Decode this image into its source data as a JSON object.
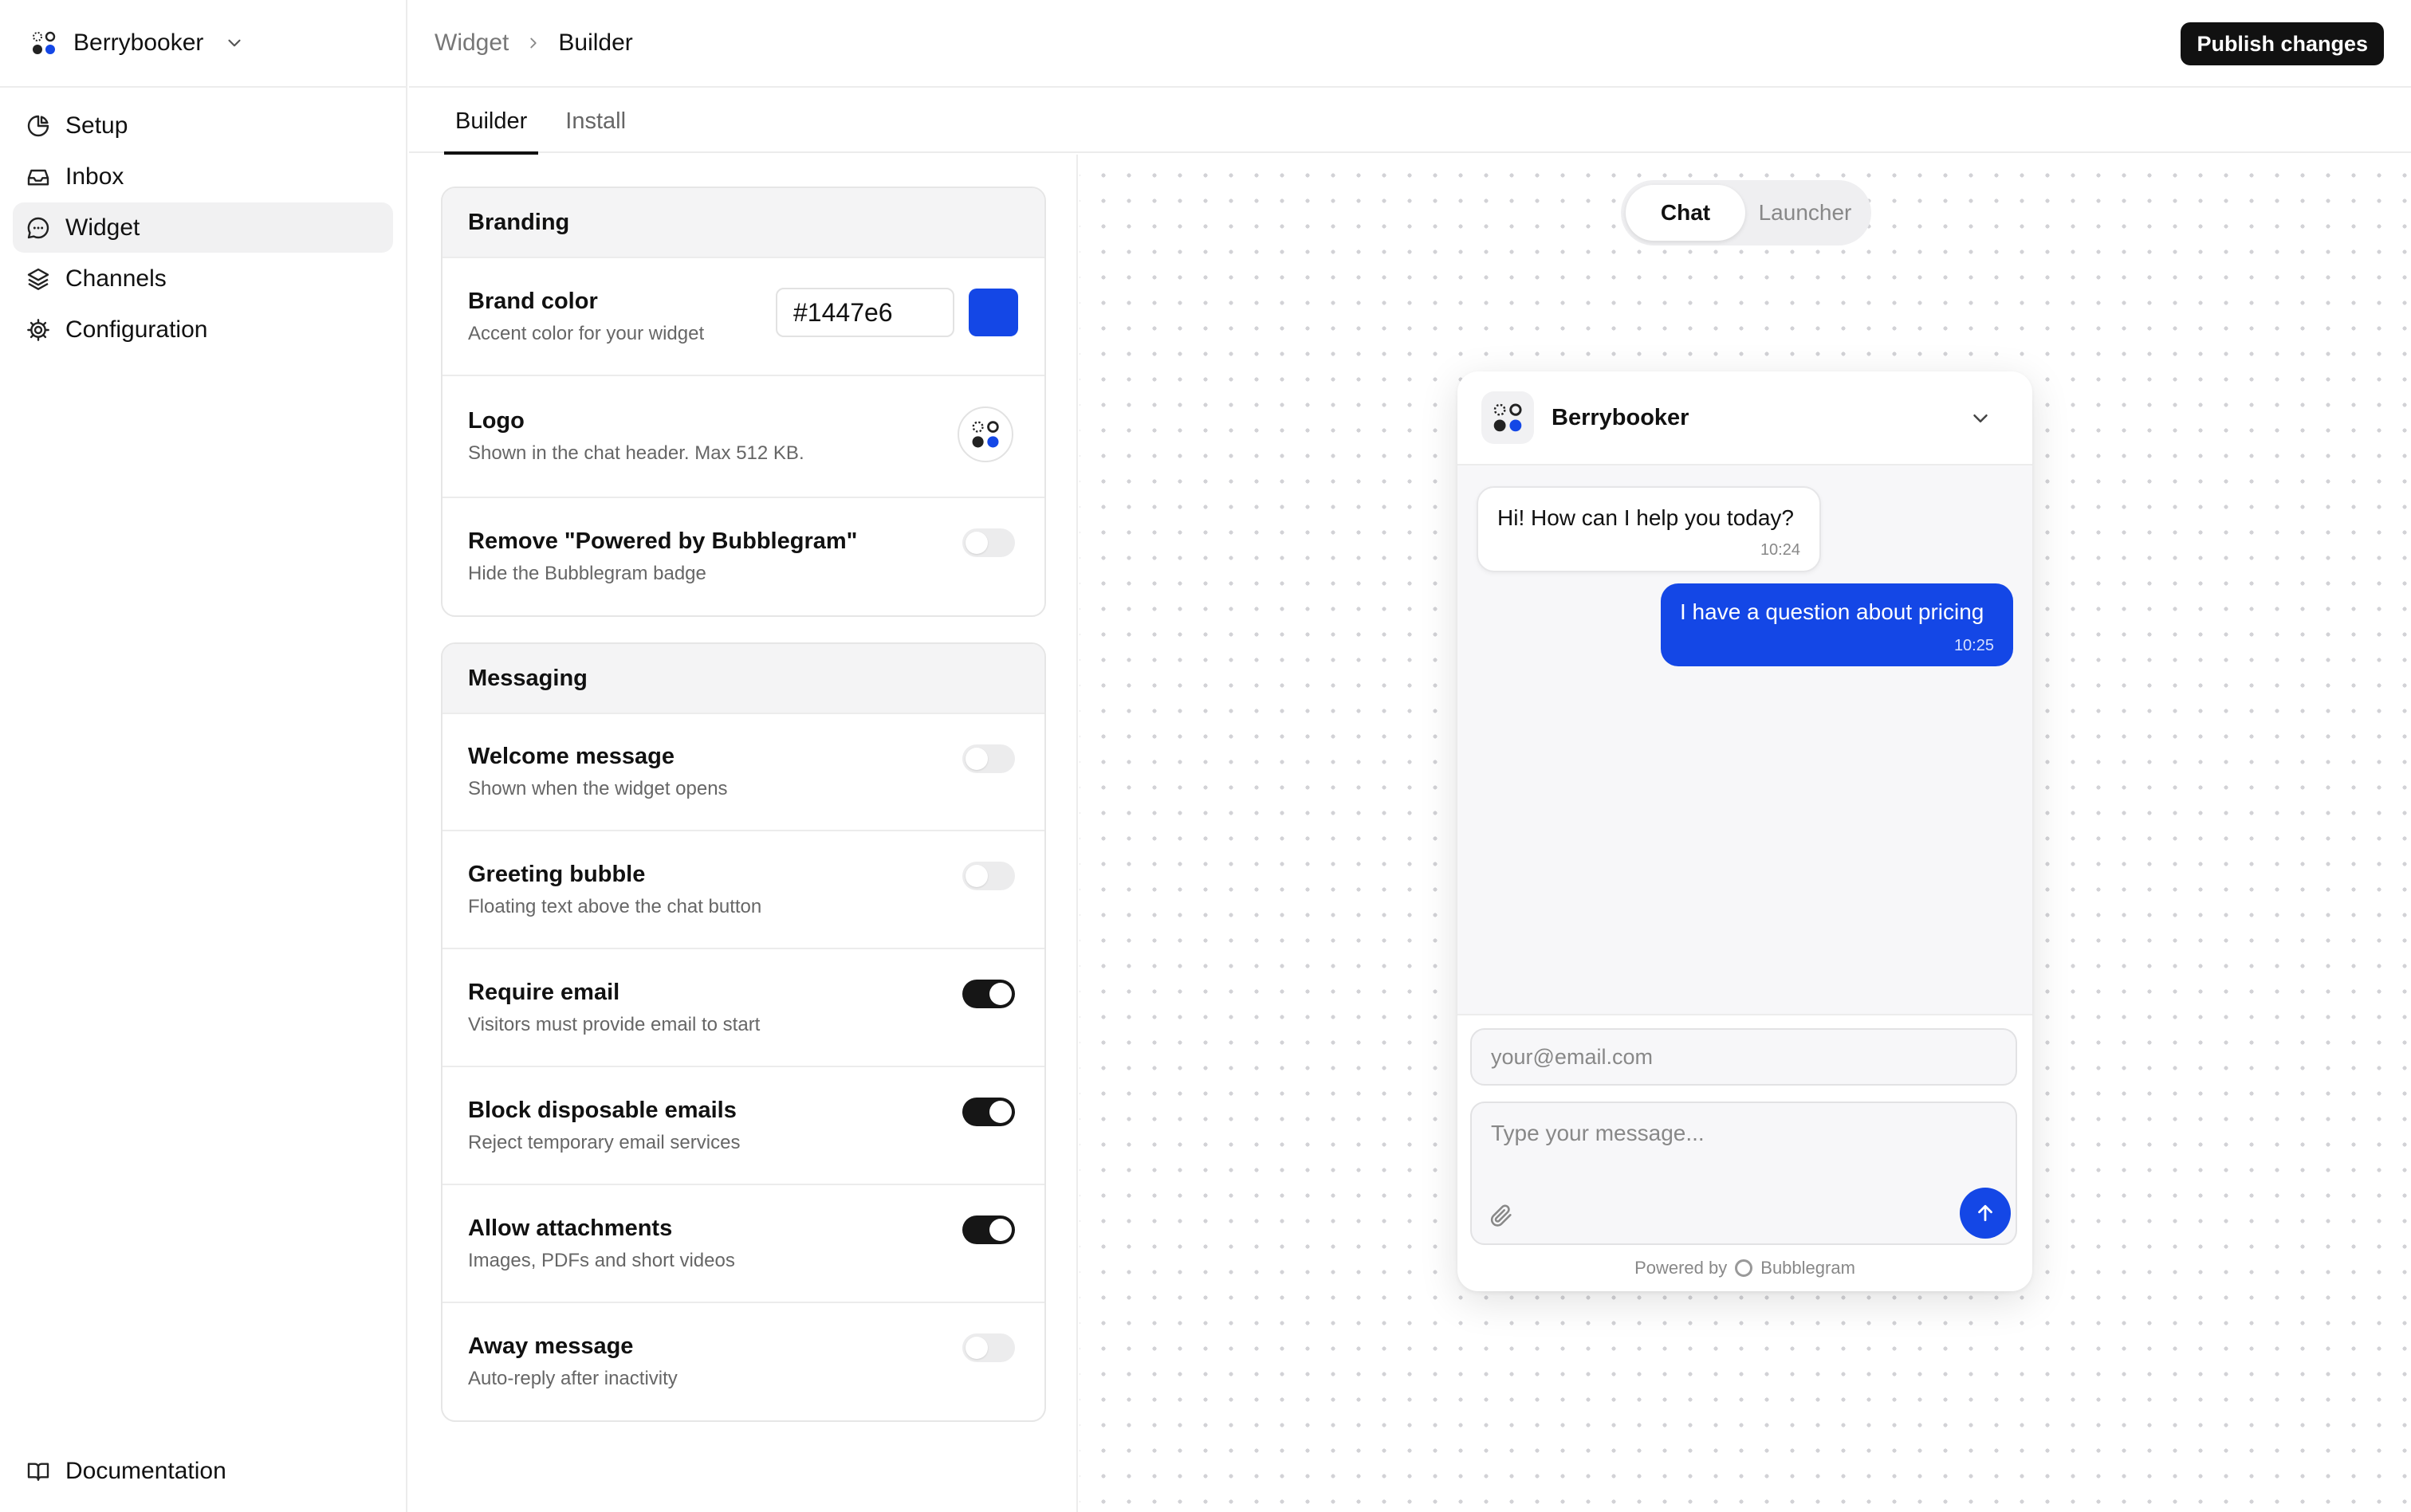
{
  "colors": {
    "brand": "#1447e6",
    "dark": "#161616"
  },
  "sidebar": {
    "workspace_name": "Berrybooker",
    "items": [
      {
        "label": "Setup",
        "icon": "pie-chart-icon"
      },
      {
        "label": "Inbox",
        "icon": "inbox-icon"
      },
      {
        "label": "Widget",
        "icon": "message-circle-icon",
        "active": true
      },
      {
        "label": "Channels",
        "icon": "layers-icon"
      },
      {
        "label": "Configuration",
        "icon": "gear-icon"
      }
    ],
    "footer_link": "Documentation"
  },
  "header": {
    "breadcrumb": [
      "Widget",
      "Builder"
    ],
    "publish_label": "Publish changes"
  },
  "tabs": [
    {
      "label": "Builder",
      "active": true
    },
    {
      "label": "Install",
      "active": false
    }
  ],
  "branding": {
    "title": "Branding",
    "brand_color": {
      "title": "Brand color",
      "subtitle": "Accent color for your widget",
      "value": "#1447e6"
    },
    "logo": {
      "title": "Logo",
      "subtitle": "Shown in the chat header. Max 512 KB."
    },
    "remove_powered": {
      "title": "Remove \"Powered by Bubblegram\"",
      "subtitle": "Hide the Bubblegram badge",
      "enabled": false
    }
  },
  "messaging": {
    "title": "Messaging",
    "rows": [
      {
        "title": "Welcome message",
        "subtitle": "Shown when the widget opens",
        "enabled": false
      },
      {
        "title": "Greeting bubble",
        "subtitle": "Floating text above the chat button",
        "enabled": false
      },
      {
        "title": "Require email",
        "subtitle": "Visitors must provide email to start",
        "enabled": true
      },
      {
        "title": "Block disposable emails",
        "subtitle": "Reject temporary email services",
        "enabled": true
      },
      {
        "title": "Allow attachments",
        "subtitle": "Images, PDFs and short videos",
        "enabled": true
      },
      {
        "title": "Away message",
        "subtitle": "Auto-reply after inactivity",
        "enabled": false
      }
    ]
  },
  "preview": {
    "mode_tabs": [
      "Chat",
      "Launcher"
    ],
    "active_mode": "Chat",
    "widget": {
      "name": "Berrybooker",
      "messages": [
        {
          "from": "agent",
          "text": "Hi! How can I help you today?",
          "time": "10:24"
        },
        {
          "from": "visitor",
          "text": "I have a question about pricing",
          "time": "10:25"
        }
      ],
      "email_placeholder": "your@email.com",
      "message_placeholder": "Type your message...",
      "powered_by_prefix": "Powered by",
      "powered_by_name": "Bubblegram"
    }
  }
}
